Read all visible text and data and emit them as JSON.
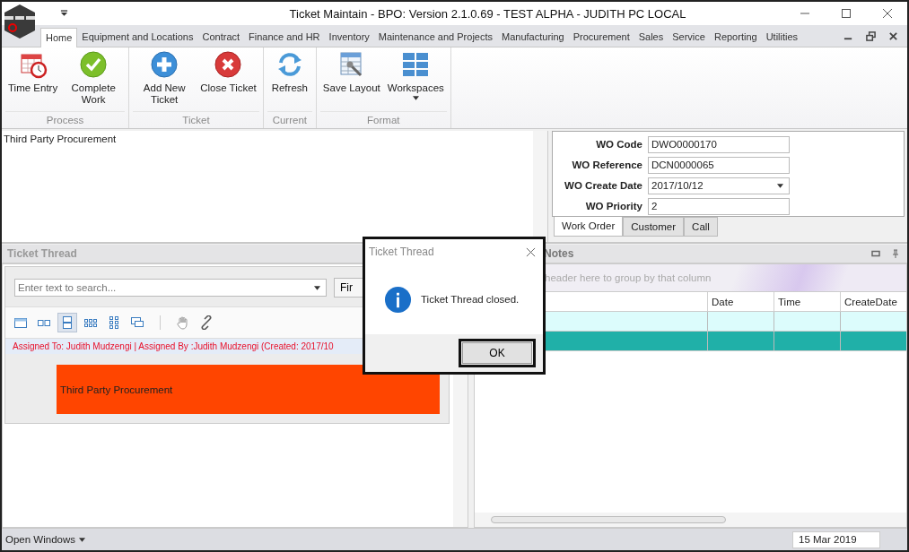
{
  "window": {
    "title": "Ticket Maintain - BPO: Version 2.1.0.69 - TEST ALPHA - JUDITH PC LOCAL"
  },
  "menu_tabs": [
    {
      "label": "Home",
      "selected": true
    },
    {
      "label": "Equipment and Locations",
      "selected": false
    },
    {
      "label": "Contract",
      "selected": false
    },
    {
      "label": "Finance and HR",
      "selected": false
    },
    {
      "label": "Inventory",
      "selected": false
    },
    {
      "label": "Maintenance and Projects",
      "selected": false
    },
    {
      "label": "Manufacturing",
      "selected": false
    },
    {
      "label": "Procurement",
      "selected": false
    },
    {
      "label": "Sales",
      "selected": false
    },
    {
      "label": "Service",
      "selected": false
    },
    {
      "label": "Reporting",
      "selected": false
    },
    {
      "label": "Utilities",
      "selected": false
    }
  ],
  "ribbon_groups": [
    {
      "label": "Process",
      "buttons": [
        {
          "label": "Time Entry",
          "kind": "calendar"
        },
        {
          "label": "Complete Work",
          "kind": "check"
        }
      ]
    },
    {
      "label": "Ticket",
      "buttons": [
        {
          "label": "Add New Ticket",
          "kind": "add"
        },
        {
          "label": "Close Ticket",
          "kind": "close"
        }
      ]
    },
    {
      "label": "Current",
      "buttons": [
        {
          "label": "Refresh",
          "kind": "refresh"
        }
      ]
    },
    {
      "label": "Format",
      "buttons": [
        {
          "label": "Save Layout",
          "kind": "layout"
        },
        {
          "label": "Workspaces",
          "kind": "workspaces"
        }
      ]
    }
  ],
  "editor": {
    "text": "Third Party Procurement"
  },
  "work_order_form": {
    "fields": [
      {
        "label": "WO Code",
        "value": "DWO0000170",
        "kind": "text"
      },
      {
        "label": "WO Reference",
        "value": "DCN0000065",
        "kind": "text"
      },
      {
        "label": "WO Create Date",
        "value": "2017/10/12",
        "kind": "dropdown"
      },
      {
        "label": "WO Priority",
        "value": "2",
        "kind": "text"
      }
    ]
  },
  "detail_tabs": [
    {
      "label": "Work Order",
      "selected": true
    },
    {
      "label": "Customer",
      "selected": false
    },
    {
      "label": "Call",
      "selected": false
    }
  ],
  "ticket_thread": {
    "title": "Ticket Thread",
    "search": {
      "placeholder": "Enter text to search..."
    },
    "find_button": "Fir",
    "toolbar": [
      {
        "kind": "card",
        "selected": false
      },
      {
        "kind": "columns",
        "selected": false
      },
      {
        "kind": "stacked",
        "selected": true
      },
      {
        "kind": "tiles",
        "selected": false
      },
      {
        "kind": "grid",
        "selected": false
      },
      {
        "kind": "monitor",
        "selected": false
      },
      {
        "kind": "hand",
        "selected": false
      },
      {
        "kind": "link",
        "selected": false
      }
    ],
    "assignment": "Assigned To: Judith Mudzengi | Assigned By :Judith Mudzengi (Created: 2017/10",
    "message": {
      "text": "Third Party Procurement",
      "color": "#ff4500"
    }
  },
  "notes": {
    "title": "Notes",
    "group_hint": "header here to group by that column",
    "columns": [
      "Date",
      "Time",
      "CreateDate"
    ],
    "rows": [
      {
        "selected": false
      },
      {
        "selected": true
      }
    ]
  },
  "dialog": {
    "title": "Ticket Thread",
    "message": "Ticket Thread closed.",
    "button": "OK"
  },
  "status_bar": {
    "open_windows": "Open Windows",
    "date": "15 Mar 2019"
  }
}
